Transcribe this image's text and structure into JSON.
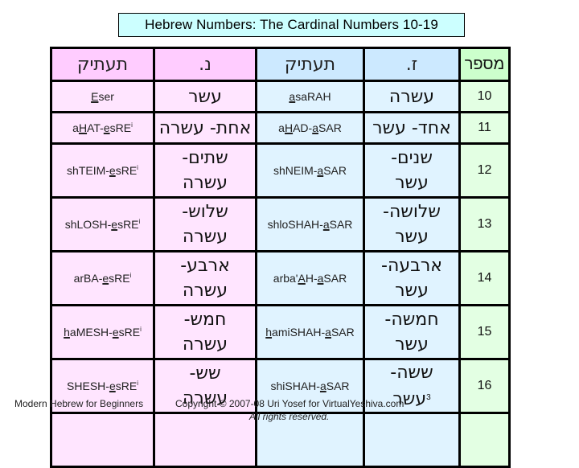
{
  "title": "Hebrew Numbers: The Cardinal Numbers 10-19",
  "headers": {
    "feminine_translit": "תעתיק",
    "feminine": "נ.",
    "masculine_translit": "תעתיק",
    "masculine": "ז.",
    "number": "מספר"
  },
  "rows": [
    {
      "feminine_translit": [
        [
          "",
          "E"
        ],
        [
          "ser",
          ""
        ]
      ],
      "feminine_translit_sup": "",
      "feminine_hebrew": [
        "עשר"
      ],
      "masculine_translit": [
        [
          "",
          "a"
        ],
        [
          "saRAH",
          ""
        ]
      ],
      "masculine_hebrew": [
        "עשרה"
      ],
      "number": "10"
    },
    {
      "feminine_translit": [
        [
          "a",
          "H"
        ],
        [
          "AT-",
          "e"
        ],
        [
          "sRE",
          ""
        ]
      ],
      "feminine_translit_sup": "i",
      "feminine_hebrew": [
        "אחת- עשרה"
      ],
      "masculine_translit": [
        [
          "a",
          "H"
        ],
        [
          "AD-",
          "a"
        ],
        [
          "SAR",
          ""
        ]
      ],
      "masculine_hebrew": [
        "אחד- עשר"
      ],
      "number": "11"
    },
    {
      "feminine_translit": [
        [
          "shTEIM-",
          "e"
        ],
        [
          "sRE",
          ""
        ]
      ],
      "feminine_translit_sup": "i",
      "feminine_hebrew": [
        "שתים-",
        "עשרה"
      ],
      "masculine_translit": [
        [
          "shNEIM-",
          "a"
        ],
        [
          "SAR",
          ""
        ]
      ],
      "masculine_hebrew": [
        "שנים-",
        "עשר"
      ],
      "number": "12"
    },
    {
      "feminine_translit": [
        [
          "shLOSH-",
          "e"
        ],
        [
          "sRE",
          ""
        ]
      ],
      "feminine_translit_sup": "i",
      "feminine_hebrew": [
        "שלוש-",
        "עשרה"
      ],
      "masculine_translit": [
        [
          "shloSHAH-",
          "a"
        ],
        [
          "SAR",
          ""
        ]
      ],
      "masculine_hebrew": [
        "שלושה-",
        "עשר"
      ],
      "number": "13"
    },
    {
      "feminine_translit": [
        [
          "arBA-",
          "e"
        ],
        [
          "sRE",
          ""
        ]
      ],
      "feminine_translit_sup": "i",
      "feminine_hebrew": [
        "ארבע-",
        "עשרה"
      ],
      "masculine_translit": [
        [
          "arba'",
          "A"
        ],
        [
          "H-",
          "a"
        ],
        [
          "SAR",
          ""
        ]
      ],
      "masculine_hebrew": [
        "ארבעה-",
        "עשר"
      ],
      "number": "14"
    },
    {
      "feminine_translit": [
        [
          "",
          "h"
        ],
        [
          "aMESH-",
          "e"
        ],
        [
          "sRE",
          ""
        ]
      ],
      "feminine_translit_sup": "i",
      "feminine_hebrew": [
        "חמש-",
        "עשרה"
      ],
      "masculine_translit": [
        [
          "",
          "h"
        ],
        [
          "amiSHAH-",
          "a"
        ],
        [
          "SAR",
          ""
        ]
      ],
      "masculine_hebrew": [
        "חמשה-",
        "עשר"
      ],
      "number": "15"
    },
    {
      "feminine_translit": [
        [
          "SHESH-",
          "e"
        ],
        [
          "sRE",
          ""
        ]
      ],
      "feminine_translit_sup": "i",
      "feminine_hebrew": [
        "שש-",
        "עשרה"
      ],
      "masculine_translit": [
        [
          "shiSHAH-",
          "a"
        ],
        [
          "SAR",
          ""
        ]
      ],
      "masculine_hebrew": [
        "ששה-",
        "עשר"
      ],
      "masculine_hebrew_sup": "3",
      "number": "16"
    }
  ],
  "footer": {
    "course": "Modern Hebrew for Beginners",
    "copyright": "Copyright © 2007-08 Uri Yosef for VirtualYeshiva.com",
    "rights": "All rights reserved."
  },
  "colors": {
    "feminine_header": "#ffccff",
    "feminine_cell": "#ffe5ff",
    "masculine_header": "#cce9ff",
    "masculine_cell": "#e0f3ff",
    "number_header": "#ccffcc",
    "number_cell": "#e3ffe3",
    "title_bg": "#ccffff"
  }
}
